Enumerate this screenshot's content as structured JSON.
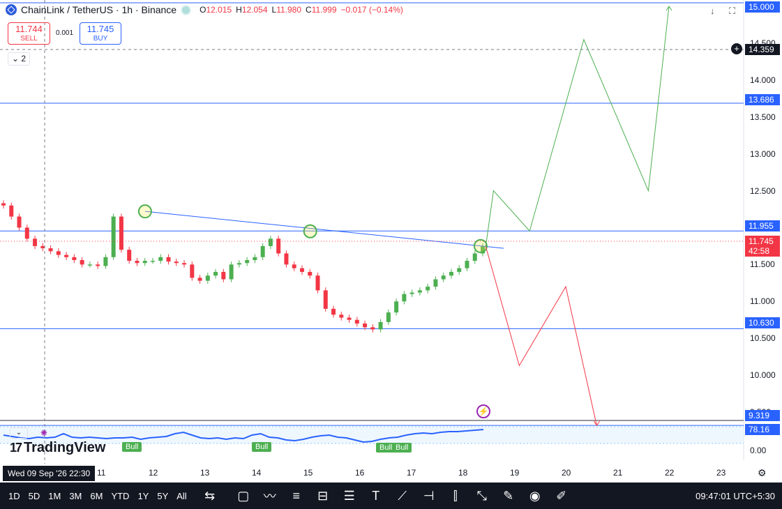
{
  "header": {
    "symbol": "ChainLink / TetherUS · 1h · Binance",
    "open_label": "O",
    "open": "12.015",
    "high_label": "H",
    "high": "12.054",
    "low_label": "L",
    "low": "11.980",
    "close_label": "C",
    "close": "11.999",
    "change": "−0.017 (−0.14%)"
  },
  "trade": {
    "sell_price": "11.744",
    "sell_label": "SELL",
    "spread": "0.001",
    "buy_price": "11.745",
    "buy_label": "BUY",
    "indicators_count": "2"
  },
  "price_labels": {
    "top": "15.000",
    "crosshair": "14.359",
    "level_1": "13.686",
    "level_2": "11.955",
    "current": "11.745",
    "countdown": "42:58",
    "level_3": "10.630",
    "level_4": "9.319"
  },
  "indicator": {
    "value": "78.16",
    "zero": "0.00",
    "signal_label": "Bull"
  },
  "branding": {
    "name": "TradingView"
  },
  "crosshair_date": "Wed 09 Sep '26   22:30",
  "toolbar": {
    "ranges": [
      "1D",
      "5D",
      "1M",
      "3M",
      "6M",
      "YTD",
      "1Y",
      "5Y",
      "All"
    ],
    "clock": "09:47:01 UTC+5:30"
  },
  "colors": {
    "up": "#4caf50",
    "down": "#f23645",
    "level": "#2962ff",
    "projection_up": "#4caf50",
    "projection_down": "#f23645"
  },
  "chart_data": {
    "type": "line",
    "title": "ChainLink / TetherUS · 1h · Binance",
    "price_levels": [
      13.686,
      11.955,
      10.63,
      9.319
    ],
    "current_price": 11.745,
    "y_ticks": [
      "9.500",
      "10.000",
      "10.500",
      "11.000",
      "11.500",
      "12.000",
      "12.500",
      "13.000",
      "13.500",
      "14.000",
      "14.500",
      "15.000"
    ],
    "x_ticks": [
      "11",
      "12",
      "13",
      "14",
      "15",
      "16",
      "17",
      "18",
      "19",
      "20",
      "21",
      "22",
      "23"
    ],
    "ylim": [
      9.2,
      15.0
    ],
    "series": [
      {
        "values": [
          12.3,
          12.15,
          12.0,
          11.85,
          11.75,
          11.72,
          11.68,
          11.63,
          11.6,
          11.56,
          11.5,
          11.5,
          11.48,
          11.6,
          12.15,
          11.7,
          11.55,
          11.52,
          11.55,
          11.55,
          11.6,
          11.54,
          11.52,
          11.5,
          11.32,
          11.28,
          11.35,
          11.4,
          11.3,
          11.5,
          11.52,
          11.56,
          11.6,
          11.75,
          11.85,
          11.65,
          11.5,
          11.45,
          11.4,
          11.35,
          11.15,
          10.9,
          10.82,
          10.78,
          10.75,
          10.7,
          10.65,
          10.62,
          10.72,
          10.85,
          11.0,
          11.1,
          11.12,
          11.15,
          11.2,
          11.3,
          11.35,
          11.4,
          11.45,
          11.55,
          11.65,
          11.75
        ]
      },
      {
        "name": "Projection up",
        "x": [
          18.45,
          18.6,
          19.3,
          20.35,
          21.6,
          22.0
        ],
        "values": [
          11.745,
          12.5,
          11.955,
          14.55,
          12.5,
          15.0
        ]
      },
      {
        "name": "Projection down",
        "x": [
          18.45,
          19.1,
          20.0,
          20.6
        ],
        "values": [
          11.745,
          10.13,
          11.2,
          9.319
        ]
      }
    ],
    "trendline": {
      "x": [
        11.85,
        15.05,
        18.35
      ],
      "values": [
        12.22,
        11.95,
        11.75
      ]
    }
  }
}
